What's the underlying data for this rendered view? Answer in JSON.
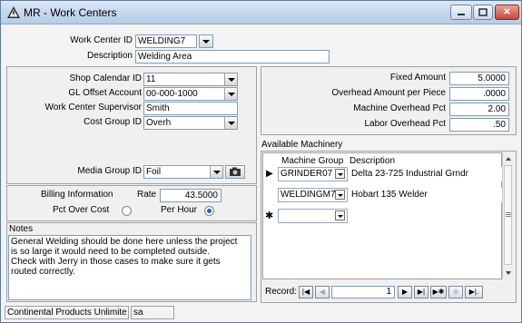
{
  "window": {
    "title": "MR - Work Centers",
    "controls": [
      "minimize",
      "maximize",
      "close"
    ]
  },
  "header": {
    "work_center_id_label": "Work Center ID",
    "work_center_id_value": "WELDING7",
    "description_label": "Description",
    "description_value": "Welding Area"
  },
  "left": {
    "shop_calendar_label": "Shop Calendar ID",
    "shop_calendar_value": "11",
    "gl_offset_label": "GL Offset Account",
    "gl_offset_value": "00-000-1000",
    "supervisor_label": "Work Center Supervisor",
    "supervisor_value": "Smith",
    "cost_group_label": "Cost Group ID",
    "cost_group_value": "Overh",
    "media_group_label": "Media Group ID",
    "media_group_value": "Foil"
  },
  "billing": {
    "billing_info_label": "Billing Information",
    "rate_label": "Rate",
    "rate_value": "43.5000",
    "pct_over_cost_label": "Pct Over Cost",
    "per_hour_label": "Per Hour",
    "selected": "per_hour"
  },
  "notes": {
    "label": "Notes",
    "lines": [
      "General Welding should be done here unless the project",
      "is so large it would need to be completed outside.",
      "Check with Jerry in those cases to make sure it gets",
      "routed correctly."
    ]
  },
  "amounts": {
    "fixed_amount_label": "Fixed Amount",
    "fixed_amount_value": "5.0000",
    "overhead_per_piece_label": "Overhead Amount per Piece",
    "overhead_per_piece_value": ".0000",
    "machine_overhead_label": "Machine Overhead Pct",
    "machine_overhead_value": "2.00",
    "labor_overhead_label": "Labor Overhead Pct",
    "labor_overhead_value": ".50"
  },
  "machinery": {
    "label": "Available Machinery",
    "columns": [
      "Machine Group",
      "Description"
    ],
    "rows": [
      {
        "group": "GRINDER07",
        "description": "Delta 23-725 Industrial Grndr",
        "indicator": "▶"
      },
      {
        "group": "WELDINGM7",
        "description": "Hobart 135 Welder",
        "indicator": ""
      }
    ],
    "new_row_indicator": "✱"
  },
  "navigator": {
    "label": "Record:",
    "current": "1"
  },
  "status": {
    "company": "Continental Products Unlimite",
    "user": "sa"
  }
}
